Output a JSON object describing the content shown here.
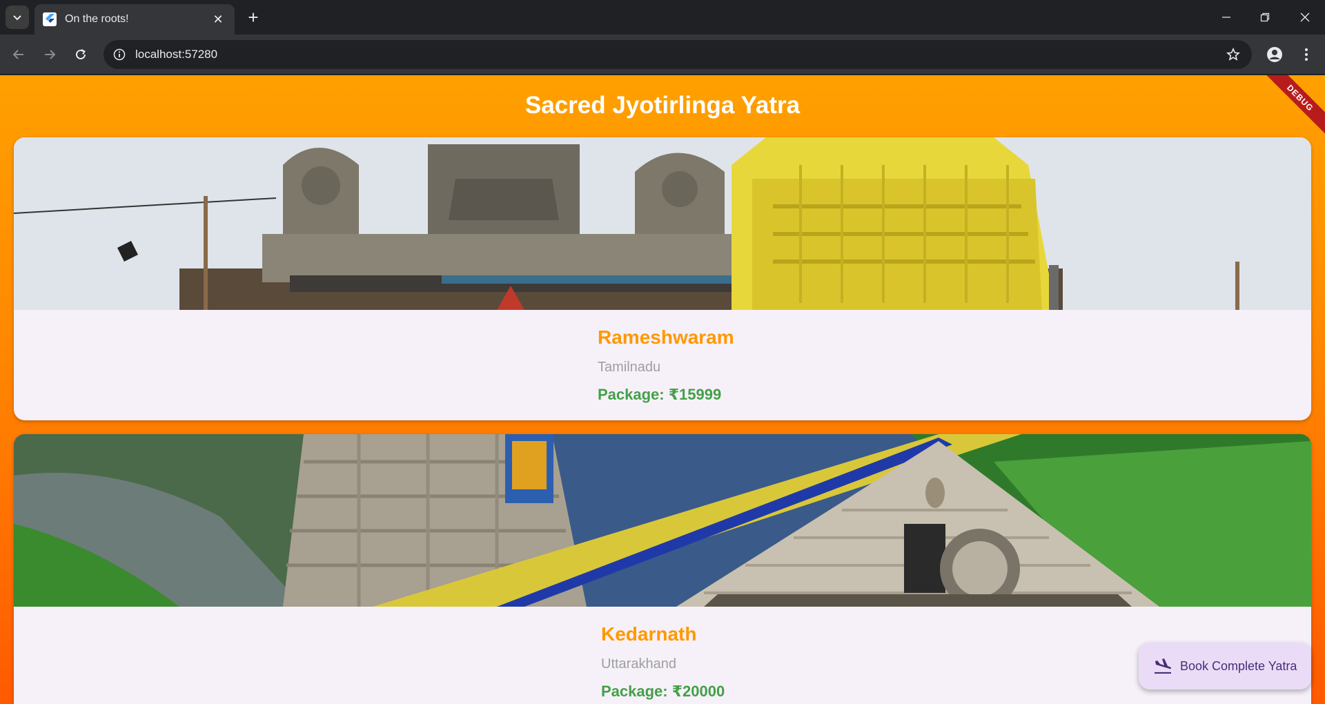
{
  "browser": {
    "tab_title": "On the roots!",
    "url": "localhost:57280"
  },
  "app": {
    "title": "Sacred Jyotirlinga Yatra",
    "debug_label": "DEBUG",
    "primary_color": "#ff9800",
    "price_color": "#43a047"
  },
  "destinations": [
    {
      "name": "Rameshwaram",
      "state": "Tamilnadu",
      "price": "Package: ₹15999"
    },
    {
      "name": "Kedarnath",
      "state": "Uttarakhand",
      "price": "Package: ₹20000"
    }
  ],
  "fab": {
    "label": "Book Complete Yatra",
    "icon": "flight-land-icon"
  }
}
